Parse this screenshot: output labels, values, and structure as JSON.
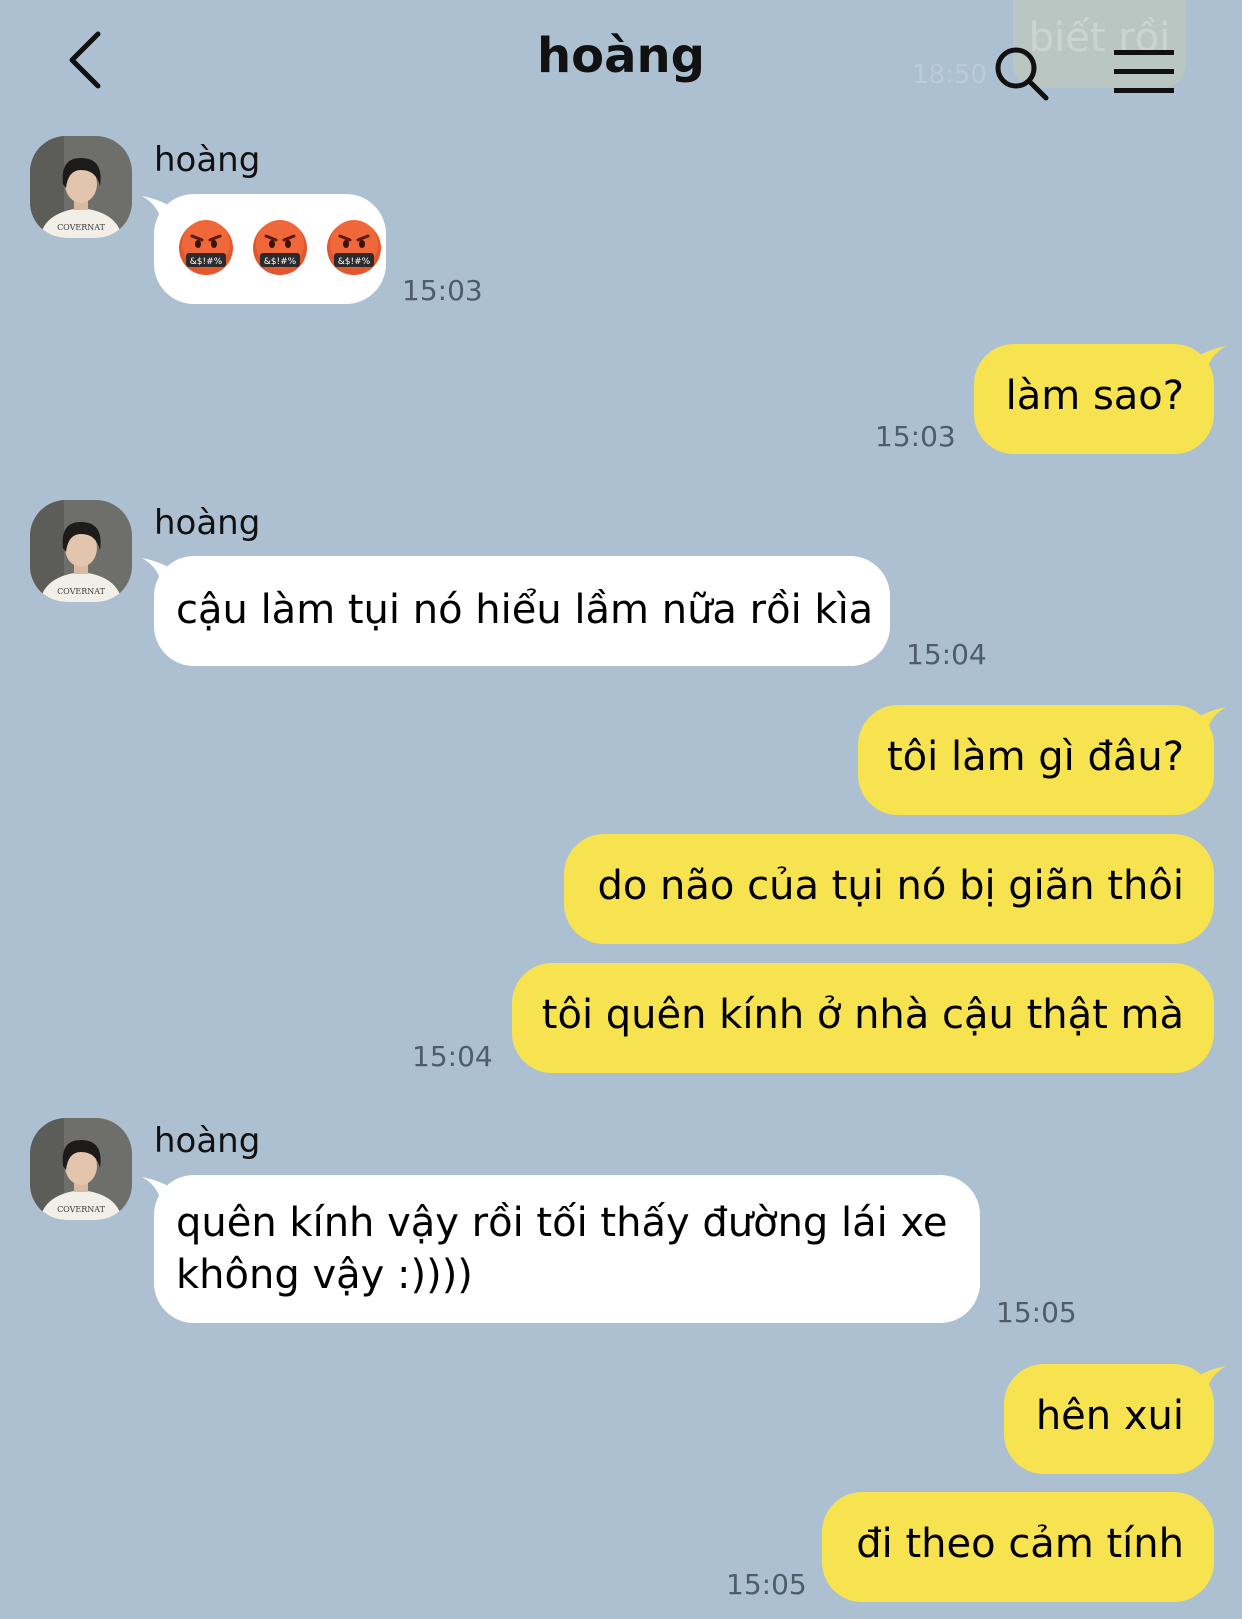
{
  "header": {
    "title": "hoàng",
    "faded_prev_message": "biết rồi",
    "faded_prev_time": "18:50"
  },
  "colors": {
    "background": "#adc0d2",
    "incoming_bubble": "#ffffff",
    "outgoing_bubble": "#f7e34f",
    "timestamp": "#4f5d6b"
  },
  "icons": {
    "back": "chevron-left-icon",
    "search": "search-icon",
    "menu": "hamburger-menu-icon",
    "emoji": "face-with-symbols-on-mouth"
  },
  "messages": [
    {
      "direction": "in",
      "sender": "hoàng",
      "emoji": [
        "🤬",
        "🤬",
        "🤬"
      ],
      "time": "15:03"
    },
    {
      "direction": "out",
      "text": "làm sao?",
      "time": "15:03"
    },
    {
      "direction": "in",
      "sender": "hoàng",
      "text": "cậu làm tụi nó hiểu lầm nữa rồi kìa",
      "time": "15:04"
    },
    {
      "direction": "out",
      "text": "tôi làm gì đâu?"
    },
    {
      "direction": "out",
      "text": "do não của tụi nó bị giãn thôi"
    },
    {
      "direction": "out",
      "text": "tôi quên kính ở nhà cậu thật mà",
      "time": "15:04"
    },
    {
      "direction": "in",
      "sender": "hoàng",
      "text_line1": "quên kính vậy rồi tối thấy đường lái xe",
      "text_line2": "không vậy :))))",
      "time": "15:05"
    },
    {
      "direction": "out",
      "text": "hên xui"
    },
    {
      "direction": "out",
      "text": "đi theo cảm tính",
      "time": "15:05"
    }
  ]
}
